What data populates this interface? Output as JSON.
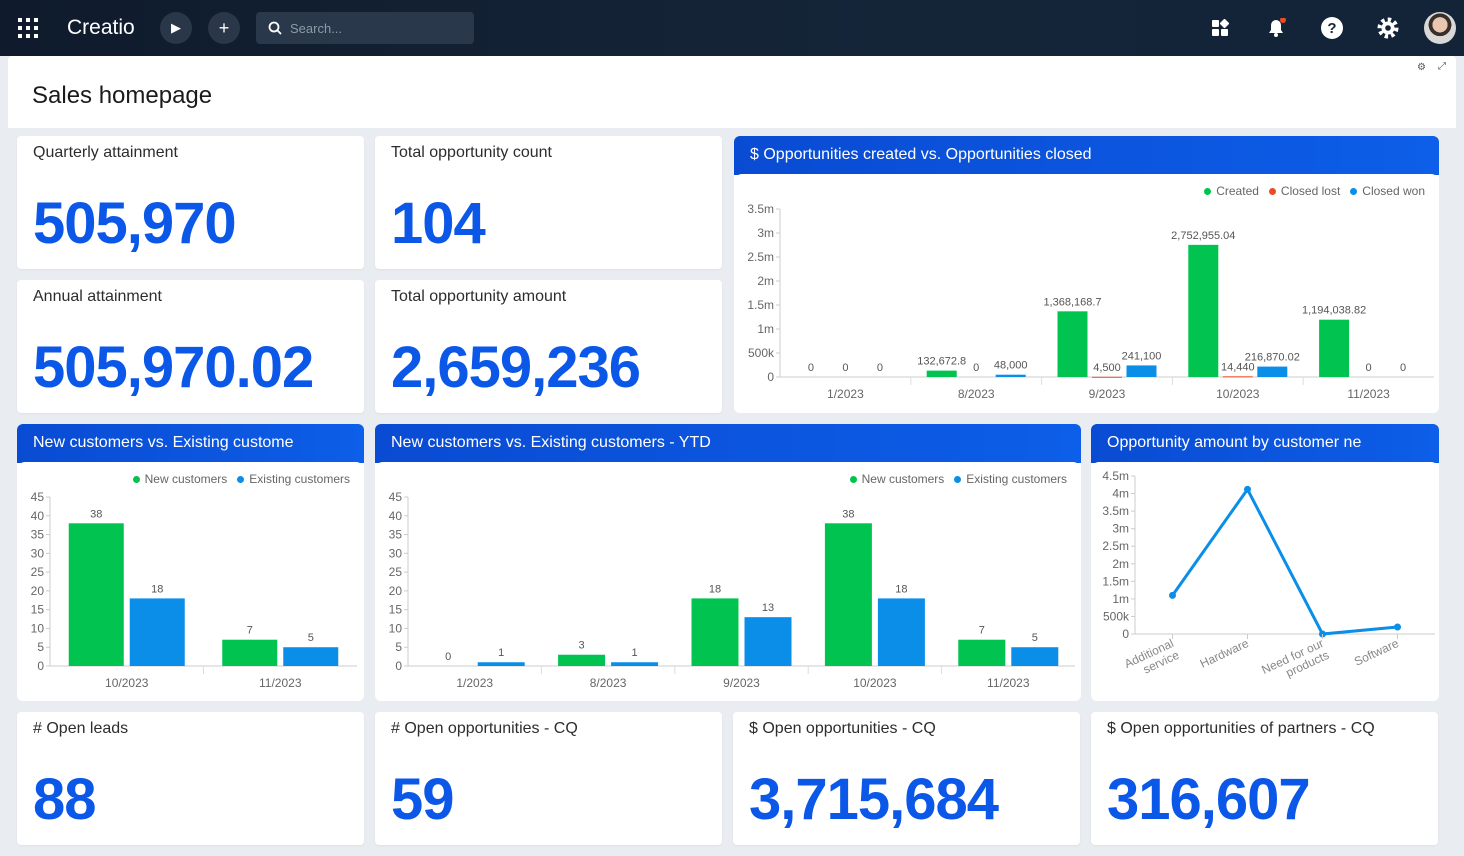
{
  "topbar": {
    "logo": "Creatio",
    "search_placeholder": "Search...",
    "icons": [
      "apps-grid-icon",
      "play-icon",
      "plus-icon",
      "search-icon",
      "widgets-icon",
      "bell-icon",
      "help-icon",
      "gear-icon",
      "avatar"
    ],
    "notification_color": "#f04a23"
  },
  "page": {
    "title": "Sales homepage"
  },
  "tiles": [
    {
      "label": "Quarterly attainment",
      "value": "505,970"
    },
    {
      "label": "Total opportunity count",
      "value": "104"
    },
    {
      "label": "Annual attainment",
      "value": "505,970.02"
    },
    {
      "label": "Total opportunity amount",
      "value": "2,659,236"
    },
    {
      "label": "# Open leads",
      "value": "88"
    },
    {
      "label": "# Open opportunities - CQ",
      "value": "59"
    },
    {
      "label": "$ Open opportunities - CQ",
      "value": "3,715,684"
    },
    {
      "label": "$ Open opportunities of partners - CQ",
      "value": "316,607"
    }
  ],
  "colors": {
    "accent": "#0b57e8",
    "green": "#00c44f",
    "red": "#f04a23",
    "blue": "#0a8ee8"
  },
  "chart_data": [
    {
      "type": "bar",
      "title": "$ Opportunities created vs. Opportunities closed",
      "categories": [
        "1/2023",
        "8/2023",
        "9/2023",
        "10/2023",
        "11/2023"
      ],
      "ylim": [
        0,
        3500000
      ],
      "yticks": [
        "0",
        "500k",
        "1m",
        "1.5m",
        "2m",
        "2.5m",
        "3m",
        "3.5m"
      ],
      "legend": "top-right",
      "series": [
        {
          "name": "Created",
          "color": "#00c44f",
          "values": [
            0,
            132672.8,
            1368168.7,
            2752955.04,
            1194038.82
          ],
          "labels": [
            "0",
            "132,672.8",
            "1,368,168.7",
            "2,752,955.04",
            "1,194,038.82"
          ]
        },
        {
          "name": "Closed lost",
          "color": "#f04a23",
          "values": [
            0,
            0,
            4500,
            14440,
            0
          ],
          "labels": [
            "0",
            "0",
            "4,500",
            "14,440",
            "0"
          ]
        },
        {
          "name": "Closed won",
          "color": "#0a8ee8",
          "values": [
            0,
            48000,
            241100,
            216870.02,
            0
          ],
          "labels": [
            "0",
            "48,000",
            "241,100",
            "216,870.02",
            "0"
          ]
        }
      ]
    },
    {
      "type": "bar",
      "title": "New customers vs. Existing custome",
      "categories": [
        "10/2023",
        "11/2023"
      ],
      "ylim": [
        0,
        45
      ],
      "yticks": [
        "0",
        "5",
        "10",
        "15",
        "20",
        "25",
        "30",
        "35",
        "40",
        "45"
      ],
      "legend": "top-right",
      "series": [
        {
          "name": "New customers",
          "color": "#00c44f",
          "values": [
            38,
            7
          ],
          "labels": [
            "38",
            "7"
          ]
        },
        {
          "name": "Existing customers",
          "color": "#0a8ee8",
          "values": [
            18,
            5
          ],
          "labels": [
            "18",
            "5"
          ]
        }
      ]
    },
    {
      "type": "bar",
      "title": "New customers vs. Existing customers - YTD",
      "categories": [
        "1/2023",
        "8/2023",
        "9/2023",
        "10/2023",
        "11/2023"
      ],
      "ylim": [
        0,
        45
      ],
      "yticks": [
        "0",
        "5",
        "10",
        "15",
        "20",
        "25",
        "30",
        "35",
        "40",
        "45"
      ],
      "legend": "top-right",
      "series": [
        {
          "name": "New customers",
          "color": "#00c44f",
          "values": [
            0,
            3,
            18,
            38,
            7
          ],
          "labels": [
            "0",
            "3",
            "18",
            "38",
            "7"
          ]
        },
        {
          "name": "Existing customers",
          "color": "#0a8ee8",
          "values": [
            1,
            1,
            13,
            18,
            5
          ],
          "labels": [
            "1",
            "1",
            "13",
            "18",
            "5"
          ]
        }
      ]
    },
    {
      "type": "line",
      "title": "Opportunity amount by customer ne",
      "categories": [
        "Additional service",
        "Hardware",
        "Need for our products",
        "Software"
      ],
      "ylim": [
        0,
        4500000
      ],
      "yticks": [
        "0",
        "500k",
        "1m",
        "1.5m",
        "2m",
        "2.5m",
        "3m",
        "3.5m",
        "4m",
        "4.5m"
      ],
      "series": [
        {
          "color": "#0a8ee8",
          "values": [
            1100000,
            4120000,
            0,
            200000
          ]
        }
      ]
    }
  ]
}
